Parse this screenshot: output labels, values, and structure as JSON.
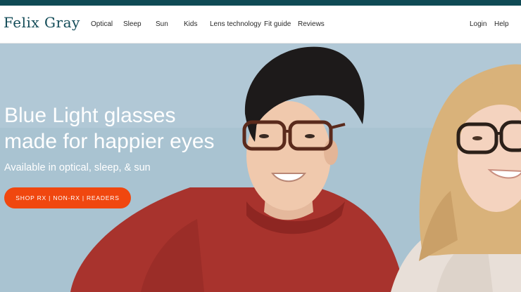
{
  "header": {
    "logo": "Felix Gray",
    "nav": [
      "Optical",
      "Sleep",
      "Sun",
      "Kids",
      "Lens technology",
      "Fit guide",
      "Reviews"
    ],
    "login": "Login",
    "help": "Help"
  },
  "hero": {
    "headline_line1": "Blue Light glasses",
    "headline_line2": "made for happier eyes",
    "subheadline": "Available in optical, sleep, & sun",
    "cta_label": "SHOP RX | NON-RX | READERS"
  },
  "colors": {
    "brand": "#124b57",
    "topbar": "#0f4a55",
    "cta": "#f0470f",
    "hero_background": "#aac4d2"
  }
}
